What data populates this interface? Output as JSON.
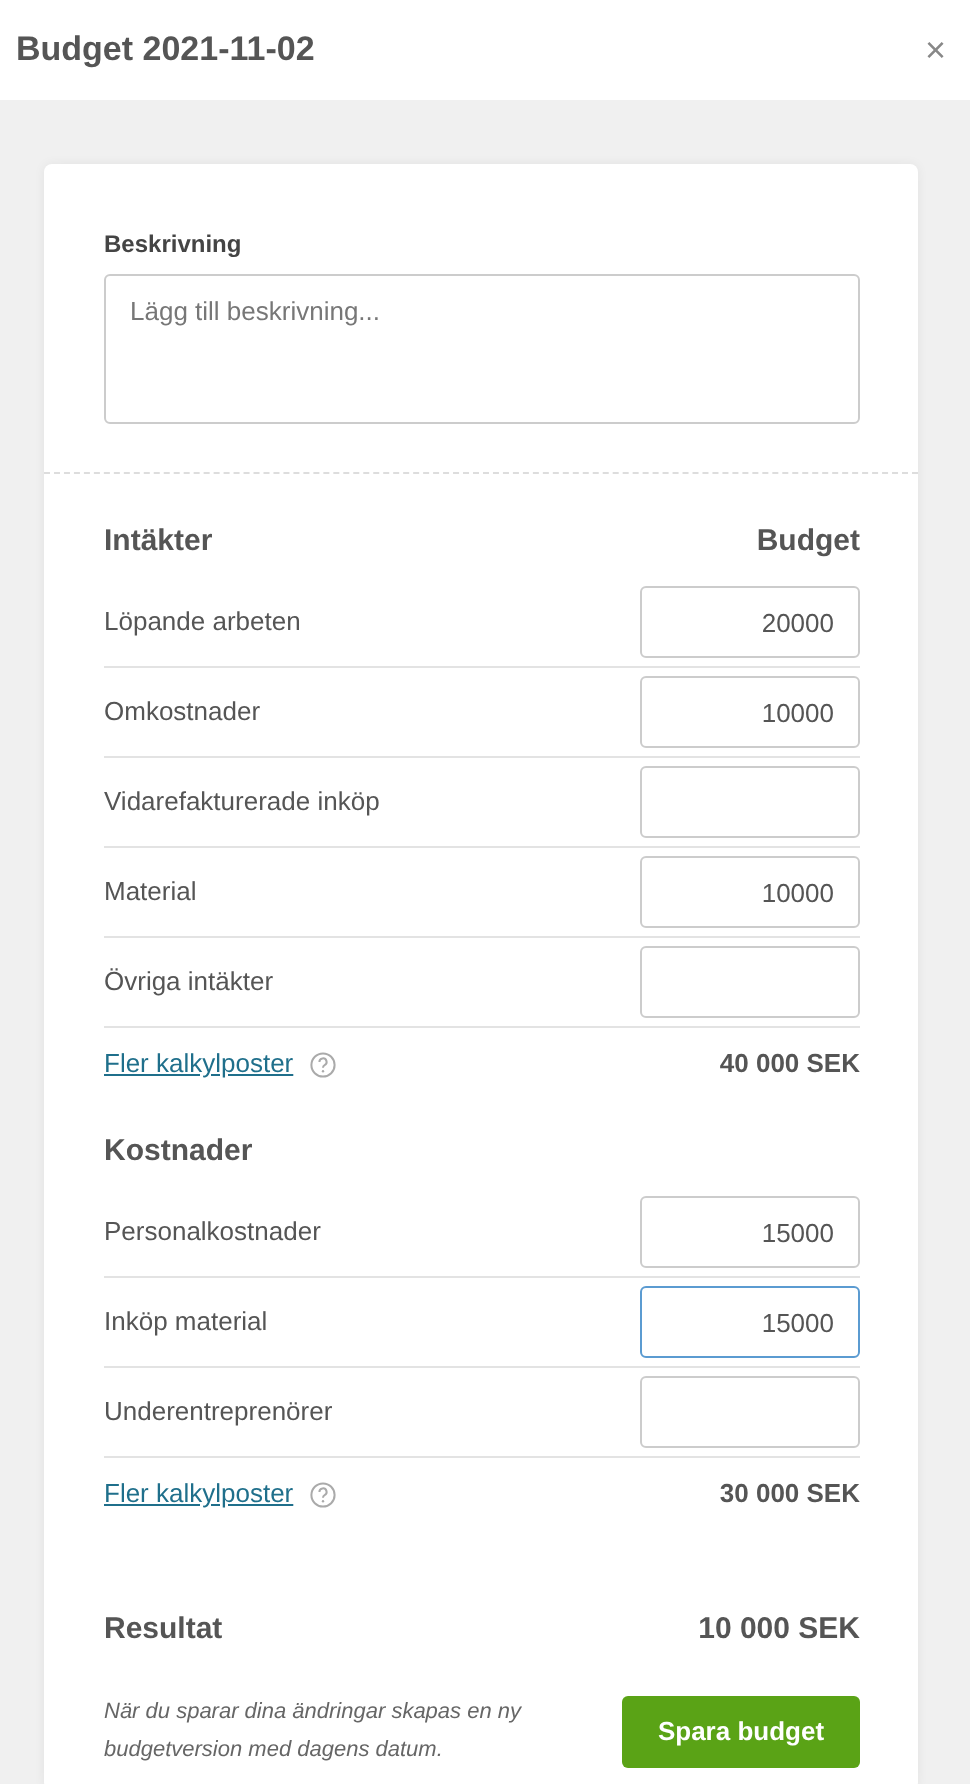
{
  "dialog": {
    "title": "Budget 2021-11-02",
    "close": "×"
  },
  "description": {
    "label": "Beskrivning",
    "placeholder": "Lägg till beskrivning..."
  },
  "sections": [
    {
      "title": "Intäkter",
      "column": "Budget",
      "rows": [
        {
          "label": "Löpande arbeten",
          "value": "20000",
          "focused": false
        },
        {
          "label": "Omkostnader",
          "value": "10000",
          "focused": false
        },
        {
          "label": "Vidarefakturerade inköp",
          "focused": false
        },
        {
          "label": "Material",
          "value": "10000",
          "focused": false
        },
        {
          "label": "Övriga intäkter",
          "focused": false
        }
      ],
      "link": "Fler kalkylposter",
      "total": "40 000 SEK"
    },
    {
      "title": "Kostnader",
      "rows": [
        {
          "label": "Personalkostnader",
          "value": "15000",
          "focused": false
        },
        {
          "label": "Inköp material",
          "value": "15000",
          "focused": true
        },
        {
          "label": "Underentreprenörer",
          "focused": false
        }
      ],
      "link": "Fler kalkylposter",
      "total": "30 000 SEK"
    }
  ],
  "result": {
    "label": "Resultat",
    "value": "10 000 SEK"
  },
  "footer": {
    "note": "När du sparar dina ändringar skapas en ny budgetversion med dagens datum.",
    "button": "Spara budget"
  }
}
